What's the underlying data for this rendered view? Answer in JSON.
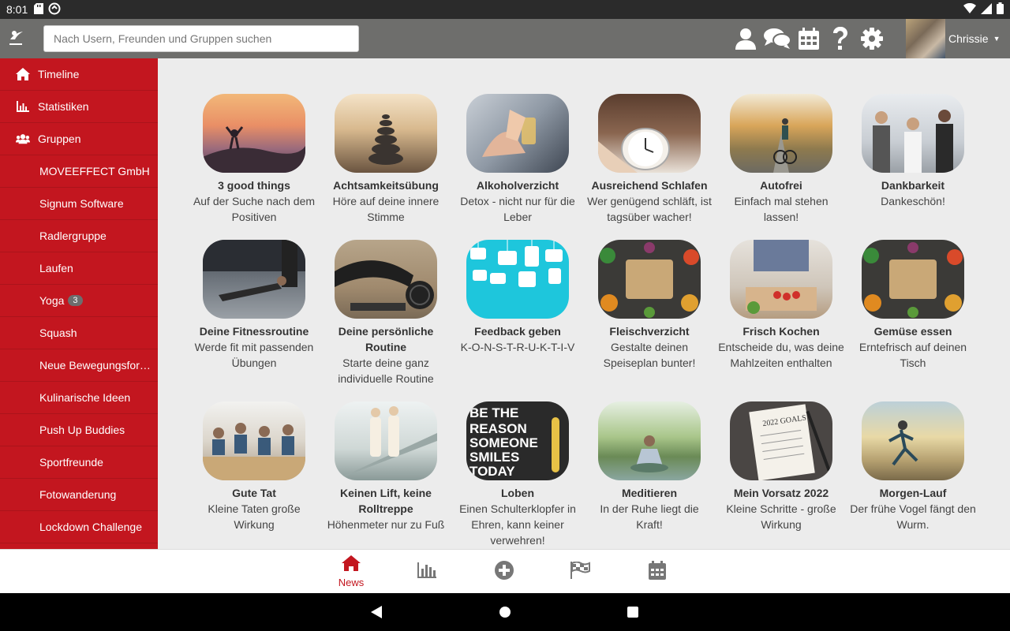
{
  "status_bar": {
    "time": "8:01"
  },
  "search": {
    "placeholder": "Nach Usern, Freunden und Gruppen suchen"
  },
  "header_icons": [
    "user-icon",
    "chat-icon",
    "calendar-icon",
    "help-icon",
    "gear-icon"
  ],
  "user": {
    "name": "Chrissie"
  },
  "sidebar": {
    "main": [
      {
        "label": "Timeline",
        "icon": "home-icon"
      },
      {
        "label": "Statistiken",
        "icon": "bar-chart-icon"
      },
      {
        "label": "Gruppen",
        "icon": "users-icon"
      }
    ],
    "groups": [
      {
        "label": "MOVEEFFECT GmbH"
      },
      {
        "label": "Signum Software"
      },
      {
        "label": "Radlergruppe"
      },
      {
        "label": "Laufen"
      },
      {
        "label": "Yoga",
        "badge": "3"
      },
      {
        "label": "Squash"
      },
      {
        "label": "Neue Bewegungsform..."
      },
      {
        "label": "Kulinarische Ideen"
      },
      {
        "label": "Push Up Buddies"
      },
      {
        "label": "Sportfreunde"
      },
      {
        "label": "Fotowanderung"
      },
      {
        "label": "Lockdown Challenge"
      }
    ]
  },
  "challenges": [
    {
      "title": "3 good things",
      "desc": "Auf der Suche nach dem Positiven"
    },
    {
      "title": "Achtsamkeitsübung",
      "desc": "Höre auf deine innere Stimme"
    },
    {
      "title": "Alkoholverzicht",
      "desc": "Detox - nicht nur für die Leber"
    },
    {
      "title": "Ausreichend Schlafen",
      "desc": "Wer genügend schläft, ist tagsüber wacher!"
    },
    {
      "title": "Autofrei",
      "desc": "Einfach mal stehen lassen!"
    },
    {
      "title": "Dankbarkeit",
      "desc": "Dankeschön!"
    },
    {
      "title": "Deine Fitnessroutine",
      "desc": "Werde fit mit passenden Übungen"
    },
    {
      "title": "Deine persönliche Routine",
      "desc": "Starte deine ganz individuelle Routine"
    },
    {
      "title": "Feedback geben",
      "desc": "K-O-N-S-T-R-U-K-T-I-V"
    },
    {
      "title": "Fleischverzicht",
      "desc": "Gestalte deinen Speiseplan bunter!"
    },
    {
      "title": "Frisch Kochen",
      "desc": "Entscheide du, was deine Mahlzeiten enthalten"
    },
    {
      "title": "Gemüse essen",
      "desc": "Erntefrisch auf deinen Tisch"
    },
    {
      "title": "Gute Tat",
      "desc": "Kleine Taten große Wirkung"
    },
    {
      "title": "Keinen Lift, keine Rolltreppe",
      "desc": "Höhenmeter nur zu Fuß"
    },
    {
      "title": "Loben",
      "desc": "Einen Schulterklopfer in Ehren, kann keiner verwehren!",
      "image_text": "BE THE REASON SOMEONE SMILES TODAY"
    },
    {
      "title": "Meditieren",
      "desc": "In der Ruhe liegt die Kraft!"
    },
    {
      "title": "Mein Vorsatz 2022",
      "desc": "Kleine Schritte - große Wirkung",
      "image_text": "2022 GOALS"
    },
    {
      "title": "Morgen-Lauf",
      "desc": "Der frühe Vogel fängt den Wurm."
    }
  ],
  "bottom_nav": {
    "active_label": "News",
    "items": [
      "news-icon",
      "statistics-icon",
      "add-icon",
      "challenges-flag-icon",
      "calendar-icon"
    ]
  },
  "colors": {
    "brand_red": "#c3161f",
    "header_gray": "#6e6e6c",
    "content_bg": "#ececec"
  }
}
